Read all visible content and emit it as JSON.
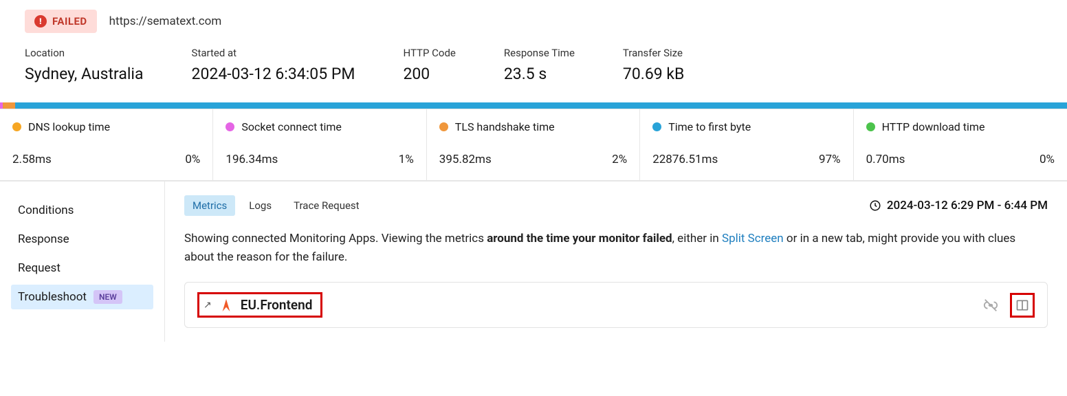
{
  "status": {
    "label": "FAILED"
  },
  "url": "https://sematext.com",
  "summary": {
    "location_label": "Location",
    "location_value": "Sydney, Australia",
    "started_label": "Started at",
    "started_value": "2024-03-12 6:34:05 PM",
    "http_label": "HTTP Code",
    "http_value": "200",
    "response_label": "Response Time",
    "response_value": "23.5 s",
    "transfer_label": "Transfer Size",
    "transfer_value": "70.69 kB"
  },
  "metrics": [
    {
      "name": "DNS lookup time",
      "value": "2.58ms",
      "pct": "0%",
      "color": "#f6a623"
    },
    {
      "name": "Socket connect time",
      "value": "196.34ms",
      "pct": "1%",
      "color": "#e565e5"
    },
    {
      "name": "TLS handshake time",
      "value": "395.82ms",
      "pct": "2%",
      "color": "#f0973c"
    },
    {
      "name": "Time to first byte",
      "value": "22876.51ms",
      "pct": "97%",
      "color": "#29a3d8"
    },
    {
      "name": "HTTP download time",
      "value": "0.70ms",
      "pct": "0%",
      "color": "#4cc34c"
    }
  ],
  "sidebar": {
    "items": [
      {
        "label": "Conditions"
      },
      {
        "label": "Response"
      },
      {
        "label": "Request"
      },
      {
        "label": "Troubleshoot",
        "badge": "NEW"
      }
    ]
  },
  "tabs": [
    {
      "label": "Metrics"
    },
    {
      "label": "Logs"
    },
    {
      "label": "Trace Request"
    }
  ],
  "time_range": "2024-03-12 6:29 PM - 6:44 PM",
  "desc": {
    "prefix": "Showing connected Monitoring Apps. Viewing the metrics ",
    "bold": "around the time your monitor failed",
    "mid": ", either in ",
    "link": "Split Screen",
    "suffix": " or in a new tab, might provide you with clues about the reason for the failure."
  },
  "app": {
    "name": "EU.Frontend"
  }
}
